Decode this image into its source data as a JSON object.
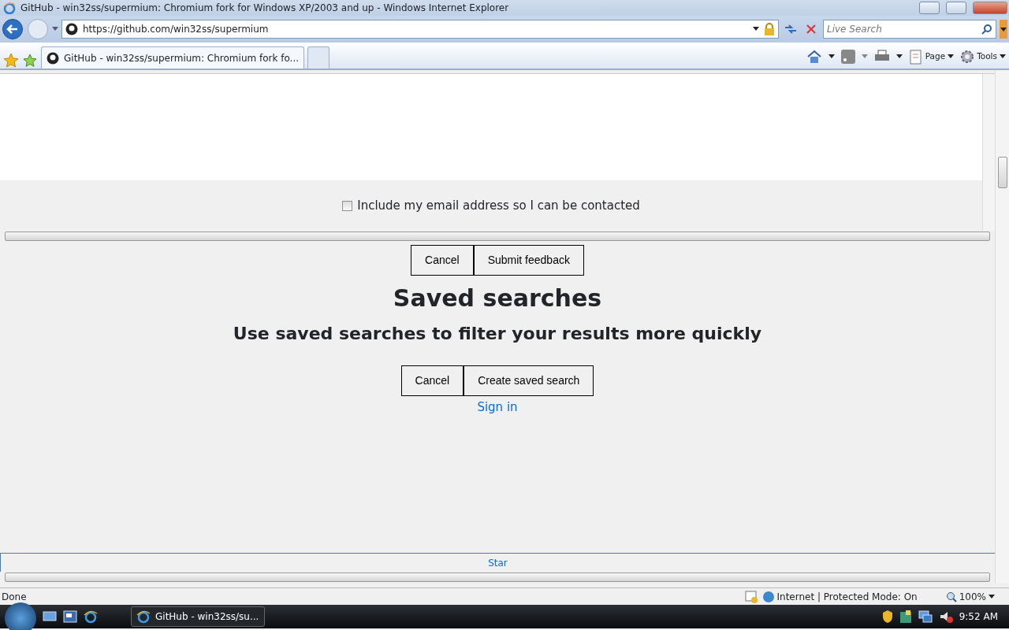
{
  "window": {
    "title": "GitHub - win32ss/supermium: Chromium fork for Windows XP/2003 and up - Windows Internet Explorer"
  },
  "address_bar": {
    "url": "https://github.com/win32ss/supermium"
  },
  "search": {
    "placeholder": "Live Search"
  },
  "tabs": [
    {
      "label": "GitHub - win32ss/supermium: Chromium fork fo...",
      "selected": true
    }
  ],
  "command_bar": [
    "Page",
    "Tools"
  ],
  "feedback": {
    "checkbox": {
      "label": "Include my email address so I can be contacted",
      "checked": false
    },
    "buttons": [
      "Cancel",
      "Submit feedback"
    ]
  },
  "saved_searches": {
    "title": "Saved searches",
    "subtitle": "Use saved searches to filter your results more quickly",
    "buttons": [
      "Cancel",
      "Create saved search"
    ],
    "sign_in": "Sign in"
  },
  "star_link": "Star",
  "status_bar": {
    "text": "Done",
    "zone": "Internet | Protected Mode: On",
    "zoom": "100%"
  },
  "taskbar": {
    "task": "GitHub - win32ss/su...",
    "clock": "9:52 AM"
  }
}
